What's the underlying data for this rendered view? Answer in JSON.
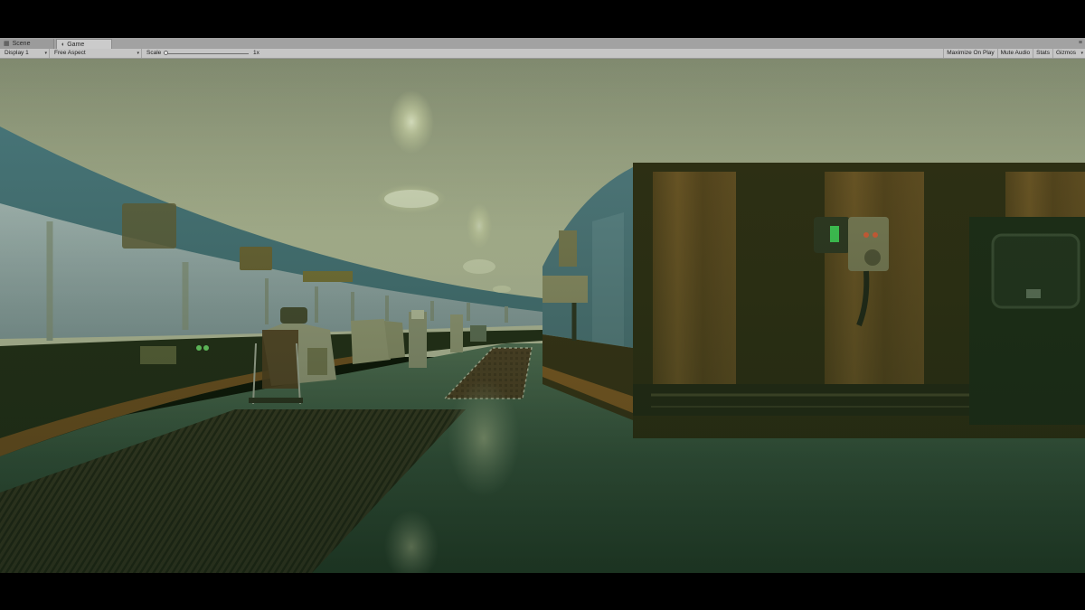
{
  "tabs": [
    {
      "label": "Scene",
      "icon": "grid-icon",
      "active": false
    },
    {
      "label": "Game",
      "icon": "pacman-icon",
      "active": true
    }
  ],
  "window_menu_icon": "menu-icon",
  "toolbar": {
    "display": "Display 1",
    "aspect": "Free Aspect",
    "scale_label": "Scale",
    "scale_value": "1x",
    "scale_fraction": 0.0,
    "maximize_on_play": "Maximize On Play",
    "mute_audio": "Mute Audio",
    "stats": "Stats",
    "gizmos": "Gizmos"
  },
  "viewport": {
    "scene": "ship-bridge",
    "colors": {
      "ceiling": "#d8d9bd",
      "floor": "#3a5a4c",
      "wood": "#6a4a22",
      "sky": "#aebfd0",
      "wall_blue": "#5d8aa0"
    }
  }
}
